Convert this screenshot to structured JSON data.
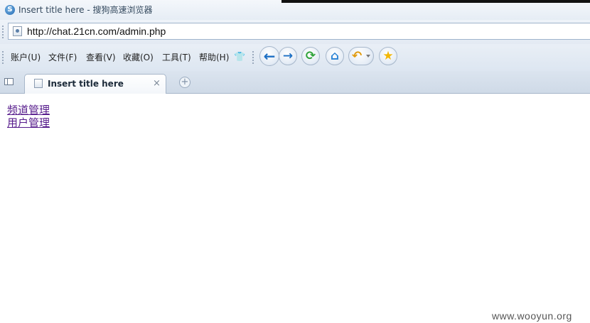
{
  "window": {
    "title": "Insert title here - 搜狗高速浏览器",
    "app_icon_glyph": "S"
  },
  "address_bar": {
    "url": "http://chat.21cn.com/admin.php"
  },
  "menu": {
    "items": [
      {
        "label": "账户(U)"
      },
      {
        "label": "文件(F)"
      },
      {
        "label": "查看(V)"
      },
      {
        "label": "收藏(O)"
      },
      {
        "label": "工具(T)"
      },
      {
        "label": "帮助(H)"
      }
    ]
  },
  "toolbar": {
    "back_glyph": "←",
    "forward_glyph": "→",
    "refresh_glyph": "⟳",
    "home_glyph": "⌂",
    "undo_glyph": "↶",
    "favorite_glyph": "★",
    "skin_glyph": "👕"
  },
  "tabs": [
    {
      "label": "Insert title here",
      "close_glyph": "×"
    }
  ],
  "new_tab_glyph": "+",
  "page": {
    "links": [
      {
        "label": "频道管理"
      },
      {
        "label": "用户管理"
      }
    ]
  },
  "watermark": "www.wooyun.org",
  "colors": {
    "link_visited": "#551a8b",
    "toolbar_bg": "#e3eaf3"
  }
}
